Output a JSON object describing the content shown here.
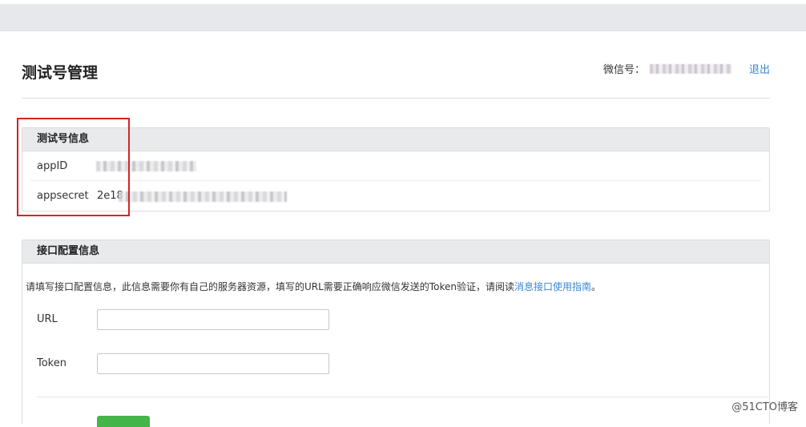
{
  "header": {
    "title": "测试号管理",
    "account_label": "微信号：",
    "logout_label": "退出"
  },
  "test_info": {
    "title": "测试号信息",
    "appid_label": "appID",
    "appsecret_label": "appsecret",
    "appsecret_prefix": "2e18"
  },
  "interface_config": {
    "title": "接口配置信息",
    "description": "请填写接口配置信息，此信息需要你有自己的服务器资源，填写的URL需要正确响应微信发送的Token验证，请阅读",
    "guide_link": "消息接口使用指南",
    "description_end": "。",
    "url_label": "URL",
    "token_label": "Token",
    "url_value": "",
    "token_value": ""
  },
  "watermark": "@51CTO博客",
  "colors": {
    "link": "#3a86d1",
    "highlight_box": "#d42424",
    "submit_button": "#44b549"
  }
}
